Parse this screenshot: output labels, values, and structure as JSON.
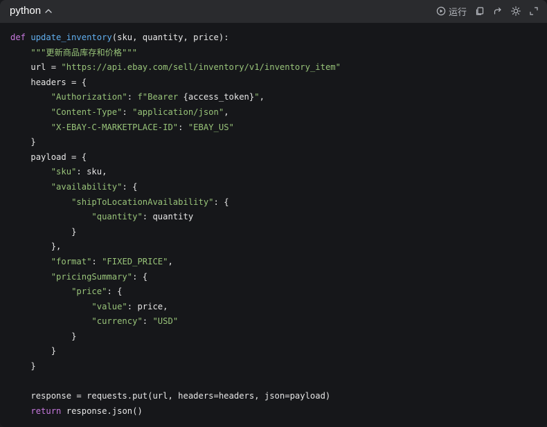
{
  "header": {
    "language": "python",
    "run_label": "运行"
  },
  "code_lines": [
    {
      "indent": "",
      "tokens": [
        {
          "t": "def",
          "c": "kw"
        },
        {
          "t": " ",
          "c": "pl"
        },
        {
          "t": "update_inventory",
          "c": "fn"
        },
        {
          "t": "(sku, quantity, price):",
          "c": "pl"
        }
      ]
    },
    {
      "indent": "    ",
      "tokens": [
        {
          "t": "\"\"\"更新商品库存和价格\"\"\"",
          "c": "str"
        }
      ]
    },
    {
      "indent": "    ",
      "tokens": [
        {
          "t": "url = ",
          "c": "pl"
        },
        {
          "t": "\"https://api.ebay.com/sell/inventory/v1/inventory_item\"",
          "c": "str"
        }
      ]
    },
    {
      "indent": "    ",
      "tokens": [
        {
          "t": "headers = {",
          "c": "pl"
        }
      ]
    },
    {
      "indent": "        ",
      "tokens": [
        {
          "t": "\"Authorization\"",
          "c": "str"
        },
        {
          "t": ": ",
          "c": "pl"
        },
        {
          "t": "f\"Bearer ",
          "c": "str"
        },
        {
          "t": "{access_token}",
          "c": "pl"
        },
        {
          "t": "\"",
          "c": "str"
        },
        {
          "t": ",",
          "c": "pl"
        }
      ]
    },
    {
      "indent": "        ",
      "tokens": [
        {
          "t": "\"Content-Type\"",
          "c": "str"
        },
        {
          "t": ": ",
          "c": "pl"
        },
        {
          "t": "\"application/json\"",
          "c": "str"
        },
        {
          "t": ",",
          "c": "pl"
        }
      ]
    },
    {
      "indent": "        ",
      "tokens": [
        {
          "t": "\"X-EBAY-C-MARKETPLACE-ID\"",
          "c": "str"
        },
        {
          "t": ": ",
          "c": "pl"
        },
        {
          "t": "\"EBAY_US\"",
          "c": "str"
        }
      ]
    },
    {
      "indent": "    ",
      "tokens": [
        {
          "t": "}",
          "c": "pl"
        }
      ]
    },
    {
      "indent": "    ",
      "tokens": [
        {
          "t": "payload = {",
          "c": "pl"
        }
      ]
    },
    {
      "indent": "        ",
      "tokens": [
        {
          "t": "\"sku\"",
          "c": "str"
        },
        {
          "t": ": sku,",
          "c": "pl"
        }
      ]
    },
    {
      "indent": "        ",
      "tokens": [
        {
          "t": "\"availability\"",
          "c": "str"
        },
        {
          "t": ": {",
          "c": "pl"
        }
      ]
    },
    {
      "indent": "            ",
      "tokens": [
        {
          "t": "\"shipToLocationAvailability\"",
          "c": "str"
        },
        {
          "t": ": {",
          "c": "pl"
        }
      ]
    },
    {
      "indent": "                ",
      "tokens": [
        {
          "t": "\"quantity\"",
          "c": "str"
        },
        {
          "t": ": quantity",
          "c": "pl"
        }
      ]
    },
    {
      "indent": "            ",
      "tokens": [
        {
          "t": "}",
          "c": "pl"
        }
      ]
    },
    {
      "indent": "        ",
      "tokens": [
        {
          "t": "},",
          "c": "pl"
        }
      ]
    },
    {
      "indent": "        ",
      "tokens": [
        {
          "t": "\"format\"",
          "c": "str"
        },
        {
          "t": ": ",
          "c": "pl"
        },
        {
          "t": "\"FIXED_PRICE\"",
          "c": "str"
        },
        {
          "t": ",",
          "c": "pl"
        }
      ]
    },
    {
      "indent": "        ",
      "tokens": [
        {
          "t": "\"pricingSummary\"",
          "c": "str"
        },
        {
          "t": ": {",
          "c": "pl"
        }
      ]
    },
    {
      "indent": "            ",
      "tokens": [
        {
          "t": "\"price\"",
          "c": "str"
        },
        {
          "t": ": {",
          "c": "pl"
        }
      ]
    },
    {
      "indent": "                ",
      "tokens": [
        {
          "t": "\"value\"",
          "c": "str"
        },
        {
          "t": ": price,",
          "c": "pl"
        }
      ]
    },
    {
      "indent": "                ",
      "tokens": [
        {
          "t": "\"currency\"",
          "c": "str"
        },
        {
          "t": ": ",
          "c": "pl"
        },
        {
          "t": "\"USD\"",
          "c": "str"
        }
      ]
    },
    {
      "indent": "            ",
      "tokens": [
        {
          "t": "}",
          "c": "pl"
        }
      ]
    },
    {
      "indent": "        ",
      "tokens": [
        {
          "t": "}",
          "c": "pl"
        }
      ]
    },
    {
      "indent": "    ",
      "tokens": [
        {
          "t": "}",
          "c": "pl"
        }
      ]
    },
    {
      "indent": "",
      "tokens": []
    },
    {
      "indent": "    ",
      "tokens": [
        {
          "t": "response = requests.put(url, headers=headers, json=payload)",
          "c": "pl"
        }
      ]
    },
    {
      "indent": "    ",
      "tokens": [
        {
          "t": "return",
          "c": "kw"
        },
        {
          "t": " response.json()",
          "c": "pl"
        }
      ]
    }
  ],
  "icons": {
    "run": "play-circle-icon",
    "copy": "copy-icon",
    "share": "share-arrow-icon",
    "theme": "sun-icon",
    "expand": "expand-icon",
    "collapse": "chevron-up-icon"
  },
  "colors": {
    "keyword": "#c678dd",
    "function": "#61afef",
    "string": "#98c379",
    "text": "#e6e6e6",
    "header_bg": "#2a2b2e",
    "code_bg": "#16171a"
  }
}
